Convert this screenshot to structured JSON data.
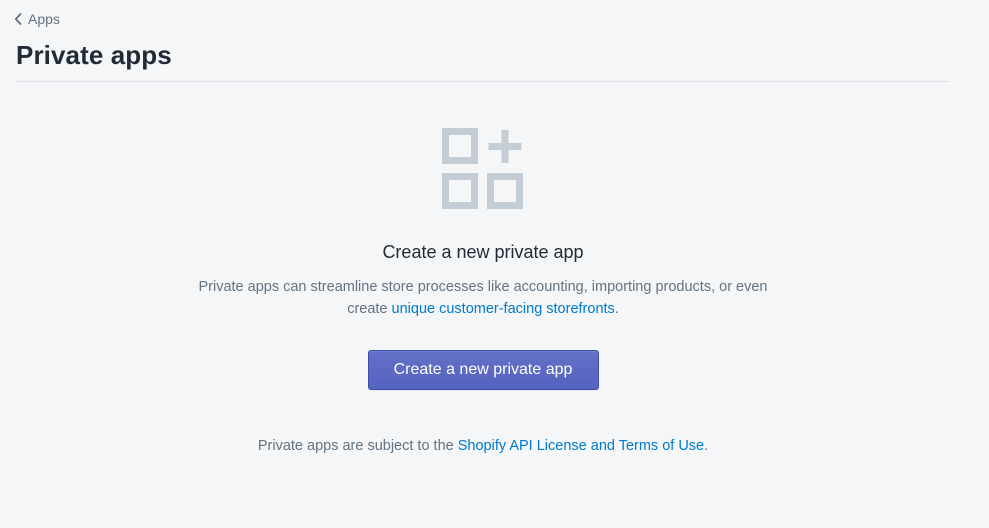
{
  "breadcrumb": {
    "label": "Apps",
    "icon": "chevron-left-icon"
  },
  "page": {
    "title": "Private apps"
  },
  "empty_state": {
    "illustration_icon": "apps-add-icon",
    "heading": "Create a new private app",
    "description_part1": "Private apps can streamline store processes like accounting, importing products, or even create ",
    "description_link": "unique customer-facing storefronts",
    "description_part2": ".",
    "button_label": "Create a new private app"
  },
  "footer": {
    "text": "Private apps are subject to the ",
    "link": "Shopify API License and Terms of Use",
    "suffix": "."
  },
  "colors": {
    "background": "#f4f6f8",
    "primary_button": "#5c6ac4",
    "link": "#007ace",
    "muted_text": "#637381",
    "illustration": "#c4cdd5"
  }
}
